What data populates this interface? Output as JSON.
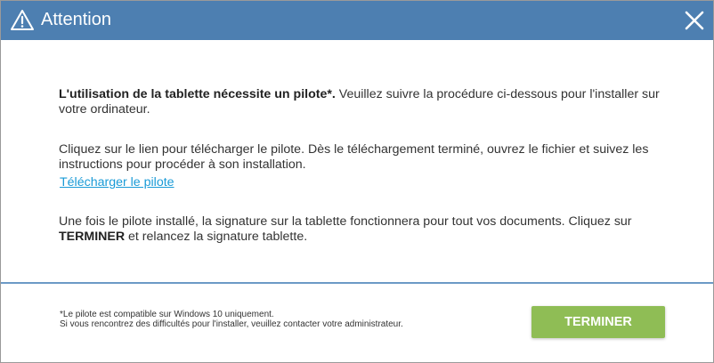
{
  "dialog": {
    "title": "Attention",
    "close_icon": "close-icon",
    "warning_icon": "warning-triangle-icon"
  },
  "content": {
    "p1_bold": "L'utilisation de la tablette nécessite un pilote*.",
    "p1_rest": " Veuillez suivre la procédure ci-dessous pour l'installer sur votre ordinateur.",
    "p2": "Cliquez sur le lien pour télécharger le pilote. Dès le téléchargement terminé, ouvrez le fichier et suivez les instructions pour procéder à son installation.",
    "download_link": "Télécharger le pilote",
    "p3_before": "Une fois le pilote installé, la signature sur la tablette fonctionnera pour tout vos documents. Cliquez sur ",
    "p3_bold": "TERMINER",
    "p3_after": " et relancez la signature tablette."
  },
  "footer": {
    "note_line1": "*Le pilote est compatible sur Windows 10 uniquement.",
    "note_line2": "Si vous rencontrez des difficultés pour l'installer, veuillez contacter votre administrateur.",
    "finish_label": "TERMINER"
  },
  "colors": {
    "titlebar": "#4d7fb1",
    "link": "#1a9bd7",
    "finish_button": "#8fbd55",
    "separator": "#6c9ac6"
  }
}
